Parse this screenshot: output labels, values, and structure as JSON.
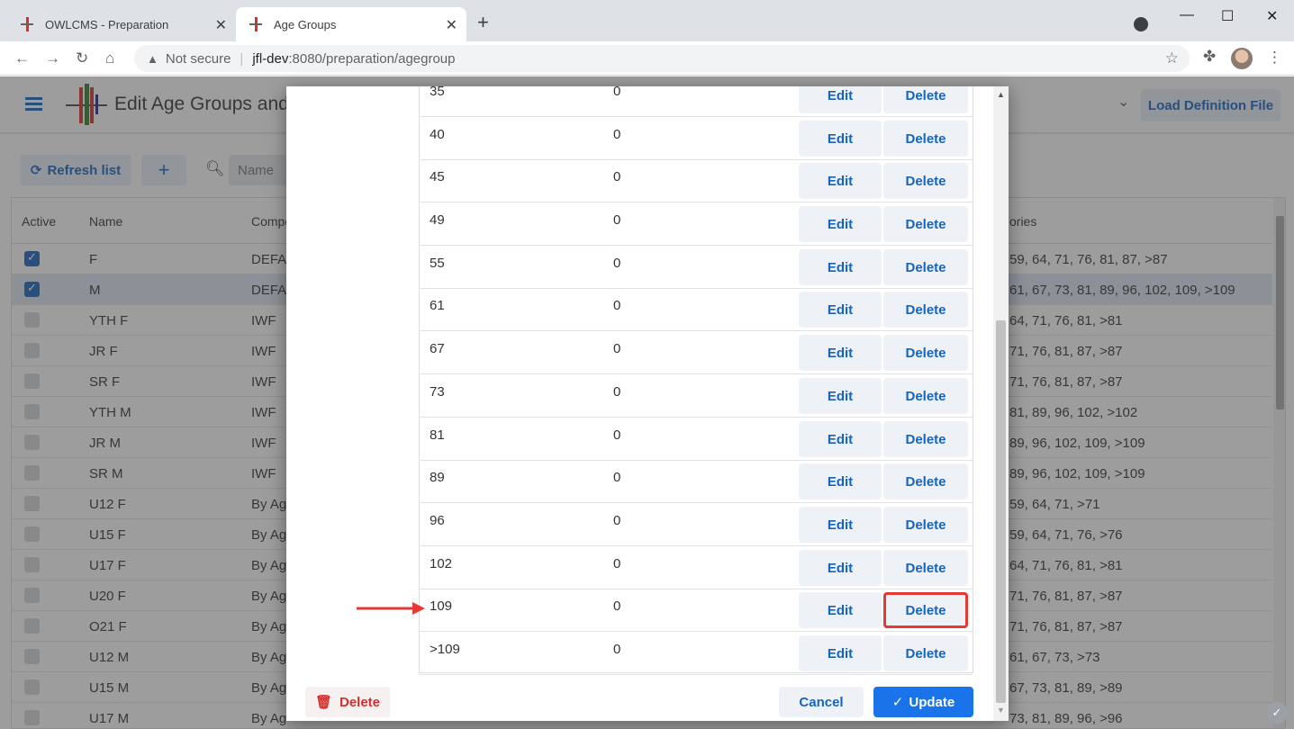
{
  "browser": {
    "tabs": [
      {
        "label": "OWLCMS - Preparation",
        "close": "✕"
      },
      {
        "label": "Age Groups",
        "close": "✕"
      }
    ],
    "new_tab": "+",
    "url_warning": "Not secure",
    "url_host": "jfl-dev",
    "url_path": ":8080/preparation/agegroup",
    "window_controls": {
      "minimize": "—",
      "maximize": "☐",
      "close": "✕"
    }
  },
  "app": {
    "title": "Edit Age Groups and",
    "load_button": "Load Definition File",
    "refresh_button": "Refresh list",
    "add_button": "+",
    "search_placeholder": "Name",
    "grid_headers": {
      "active": "Active",
      "name": "Name",
      "competition": "Compe",
      "categories": "ories"
    },
    "rows": [
      {
        "name": "F",
        "comp": "DEFAU",
        "cats": "59, 64, 71, 76, 81, 87, >87",
        "active": true
      },
      {
        "name": "M",
        "comp": "DEFAU",
        "cats": "61, 67, 73, 81, 89, 96, 102, 109, >109",
        "active": true
      },
      {
        "name": "YTH F",
        "comp": "IWF",
        "cats": "64, 71, 76, 81, >81",
        "active": false
      },
      {
        "name": "JR F",
        "comp": "IWF",
        "cats": "71, 76, 81, 87, >87",
        "active": false
      },
      {
        "name": "SR F",
        "comp": "IWF",
        "cats": "71, 76, 81, 87, >87",
        "active": false
      },
      {
        "name": "YTH M",
        "comp": "IWF",
        "cats": "81, 89, 96, 102, >102",
        "active": false
      },
      {
        "name": "JR M",
        "comp": "IWF",
        "cats": "89, 96, 102, 109, >109",
        "active": false
      },
      {
        "name": "SR M",
        "comp": "IWF",
        "cats": "89, 96, 102, 109, >109",
        "active": false
      },
      {
        "name": "U12 F",
        "comp": "By Ag",
        "cats": "59, 64, 71, >71",
        "active": false
      },
      {
        "name": "U15 F",
        "comp": "By Ag",
        "cats": "59, 64, 71, 76, >76",
        "active": false
      },
      {
        "name": "U17 F",
        "comp": "By Ag",
        "cats": "64, 71, 76, 81, >81",
        "active": false
      },
      {
        "name": "U20 F",
        "comp": "By Ag",
        "cats": "71, 76, 81, 87, >87",
        "active": false
      },
      {
        "name": "O21 F",
        "comp": "By Ag",
        "cats": "71, 76, 81, 87, >87",
        "active": false
      },
      {
        "name": "U12 M",
        "comp": "By Ag",
        "cats": "61, 67, 73, >73",
        "active": false
      },
      {
        "name": "U15 M",
        "comp": "By Ag",
        "cats": "67, 73, 81, 89, >89",
        "active": false
      },
      {
        "name": "U17 M",
        "comp": "By Ag",
        "cats": "73, 81, 89, 96, >96",
        "active": false
      }
    ]
  },
  "dialog": {
    "categories": [
      {
        "limit": "35",
        "count": "0"
      },
      {
        "limit": "40",
        "count": "0"
      },
      {
        "limit": "45",
        "count": "0"
      },
      {
        "limit": "49",
        "count": "0"
      },
      {
        "limit": "55",
        "count": "0"
      },
      {
        "limit": "61",
        "count": "0"
      },
      {
        "limit": "67",
        "count": "0"
      },
      {
        "limit": "73",
        "count": "0"
      },
      {
        "limit": "81",
        "count": "0"
      },
      {
        "limit": "89",
        "count": "0"
      },
      {
        "limit": "96",
        "count": "0"
      },
      {
        "limit": "102",
        "count": "0"
      },
      {
        "limit": "109",
        "count": "0"
      },
      {
        "limit": ">109",
        "count": "0"
      }
    ],
    "edit_label": "Edit",
    "delete_label": "Delete",
    "delete_button": "Delete",
    "cancel_button": "Cancel",
    "update_button": "Update",
    "highlighted_row": "109"
  },
  "colors": {
    "accent": "#1a73e8",
    "highlight": "#e53935",
    "danger": "#d32f2f"
  }
}
